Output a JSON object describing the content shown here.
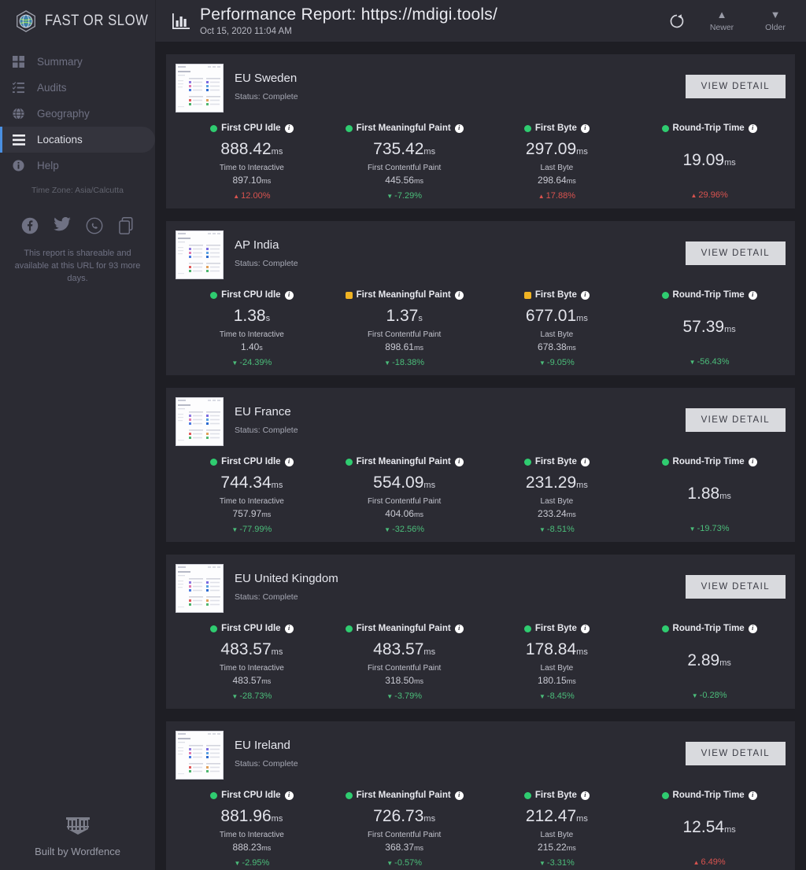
{
  "brand": {
    "name": "FAST OR SLOW",
    "logo_icon": "globe-logo-icon"
  },
  "sidebar": {
    "items": [
      {
        "label": "Summary",
        "icon": "grid-icon",
        "active": false
      },
      {
        "label": "Audits",
        "icon": "checklist-icon",
        "active": false
      },
      {
        "label": "Geography",
        "icon": "globe-icon",
        "active": false
      },
      {
        "label": "Locations",
        "icon": "list-lines-icon",
        "active": true
      },
      {
        "label": "Help",
        "icon": "info-circle-icon",
        "active": false
      }
    ],
    "timezone": "Time Zone: Asia/Calcutta",
    "social": [
      "facebook-icon",
      "twitter-icon",
      "whatsapp-icon",
      "copy-link-icon"
    ],
    "share_note": "This report is shareable and available at this URL for 93 more days.",
    "footer": {
      "label": "Built by Wordfence",
      "icon": "wordfence-icon"
    }
  },
  "topbar": {
    "icon": "bar-chart-icon",
    "title": "Performance Report: https://mdigi.tools/",
    "subtitle": "Oct 15, 2020 11:04 AM",
    "refresh_icon": "refresh-icon",
    "newer": {
      "label": "Newer",
      "icon": "triangle-up-icon"
    },
    "older": {
      "label": "Older",
      "icon": "triangle-down-icon"
    }
  },
  "colors": {
    "good": "#2fcc70",
    "warn": "#f0b323",
    "up": "#d9534f",
    "down": "#4bbd7a",
    "accent": "#4a90e2",
    "card_bg": "#2b2b33",
    "page_bg": "#1e1e24"
  },
  "view_detail_label": "VIEW DETAIL",
  "cards": [
    {
      "name": "EU Sweden",
      "status": "Status: Complete",
      "metrics": [
        {
          "label": "First CPU Idle",
          "state": "good",
          "shape": "circle",
          "value": "888.42",
          "unit": "ms",
          "sublabel": "Time to Interactive",
          "secondary": "897.10",
          "secondary_unit": "ms",
          "delta": "12.00%",
          "delta_dir": "up"
        },
        {
          "label": "First Meaningful Paint",
          "state": "good",
          "shape": "circle",
          "value": "735.42",
          "unit": "ms",
          "sublabel": "First Contentful Paint",
          "secondary": "445.56",
          "secondary_unit": "ms",
          "delta": "-7.29%",
          "delta_dir": "down"
        },
        {
          "label": "First Byte",
          "state": "good",
          "shape": "circle",
          "value": "297.09",
          "unit": "ms",
          "sublabel": "Last Byte",
          "secondary": "298.64",
          "secondary_unit": "ms",
          "delta": "17.88%",
          "delta_dir": "up"
        },
        {
          "label": "Round-Trip Time",
          "state": "good",
          "shape": "circle",
          "value": "19.09",
          "unit": "ms",
          "sublabel": "",
          "secondary": "",
          "secondary_unit": "",
          "delta": "29.96%",
          "delta_dir": "up"
        }
      ]
    },
    {
      "name": "AP India",
      "status": "Status: Complete",
      "metrics": [
        {
          "label": "First CPU Idle",
          "state": "good",
          "shape": "circle",
          "value": "1.38",
          "unit": "s",
          "sublabel": "Time to Interactive",
          "secondary": "1.40",
          "secondary_unit": "s",
          "delta": "-24.39%",
          "delta_dir": "down"
        },
        {
          "label": "First Meaningful Paint",
          "state": "warn",
          "shape": "square",
          "value": "1.37",
          "unit": "s",
          "sublabel": "First Contentful Paint",
          "secondary": "898.61",
          "secondary_unit": "ms",
          "delta": "-18.38%",
          "delta_dir": "down"
        },
        {
          "label": "First Byte",
          "state": "warn",
          "shape": "square",
          "value": "677.01",
          "unit": "ms",
          "sublabel": "Last Byte",
          "secondary": "678.38",
          "secondary_unit": "ms",
          "delta": "-9.05%",
          "delta_dir": "down"
        },
        {
          "label": "Round-Trip Time",
          "state": "good",
          "shape": "circle",
          "value": "57.39",
          "unit": "ms",
          "sublabel": "",
          "secondary": "",
          "secondary_unit": "",
          "delta": "-56.43%",
          "delta_dir": "down"
        }
      ]
    },
    {
      "name": "EU France",
      "status": "Status: Complete",
      "metrics": [
        {
          "label": "First CPU Idle",
          "state": "good",
          "shape": "circle",
          "value": "744.34",
          "unit": "ms",
          "sublabel": "Time to Interactive",
          "secondary": "757.97",
          "secondary_unit": "ms",
          "delta": "-77.99%",
          "delta_dir": "down"
        },
        {
          "label": "First Meaningful Paint",
          "state": "good",
          "shape": "circle",
          "value": "554.09",
          "unit": "ms",
          "sublabel": "First Contentful Paint",
          "secondary": "404.06",
          "secondary_unit": "ms",
          "delta": "-32.56%",
          "delta_dir": "down"
        },
        {
          "label": "First Byte",
          "state": "good",
          "shape": "circle",
          "value": "231.29",
          "unit": "ms",
          "sublabel": "Last Byte",
          "secondary": "233.24",
          "secondary_unit": "ms",
          "delta": "-8.51%",
          "delta_dir": "down"
        },
        {
          "label": "Round-Trip Time",
          "state": "good",
          "shape": "circle",
          "value": "1.88",
          "unit": "ms",
          "sublabel": "",
          "secondary": "",
          "secondary_unit": "",
          "delta": "-19.73%",
          "delta_dir": "down"
        }
      ]
    },
    {
      "name": "EU United Kingdom",
      "status": "Status: Complete",
      "metrics": [
        {
          "label": "First CPU Idle",
          "state": "good",
          "shape": "circle",
          "value": "483.57",
          "unit": "ms",
          "sublabel": "Time to Interactive",
          "secondary": "483.57",
          "secondary_unit": "ms",
          "delta": "-28.73%",
          "delta_dir": "down"
        },
        {
          "label": "First Meaningful Paint",
          "state": "good",
          "shape": "circle",
          "value": "483.57",
          "unit": "ms",
          "sublabel": "First Contentful Paint",
          "secondary": "318.50",
          "secondary_unit": "ms",
          "delta": "-3.79%",
          "delta_dir": "down"
        },
        {
          "label": "First Byte",
          "state": "good",
          "shape": "circle",
          "value": "178.84",
          "unit": "ms",
          "sublabel": "Last Byte",
          "secondary": "180.15",
          "secondary_unit": "ms",
          "delta": "-8.45%",
          "delta_dir": "down"
        },
        {
          "label": "Round-Trip Time",
          "state": "good",
          "shape": "circle",
          "value": "2.89",
          "unit": "ms",
          "sublabel": "",
          "secondary": "",
          "secondary_unit": "",
          "delta": "-0.28%",
          "delta_dir": "down"
        }
      ]
    },
    {
      "name": "EU Ireland",
      "status": "Status: Complete",
      "metrics": [
        {
          "label": "First CPU Idle",
          "state": "good",
          "shape": "circle",
          "value": "881.96",
          "unit": "ms",
          "sublabel": "Time to Interactive",
          "secondary": "888.23",
          "secondary_unit": "ms",
          "delta": "-2.95%",
          "delta_dir": "down"
        },
        {
          "label": "First Meaningful Paint",
          "state": "good",
          "shape": "circle",
          "value": "726.73",
          "unit": "ms",
          "sublabel": "First Contentful Paint",
          "secondary": "368.37",
          "secondary_unit": "ms",
          "delta": "-0.57%",
          "delta_dir": "down"
        },
        {
          "label": "First Byte",
          "state": "good",
          "shape": "circle",
          "value": "212.47",
          "unit": "ms",
          "sublabel": "Last Byte",
          "secondary": "215.22",
          "secondary_unit": "ms",
          "delta": "-3.31%",
          "delta_dir": "down"
        },
        {
          "label": "Round-Trip Time",
          "state": "good",
          "shape": "circle",
          "value": "12.54",
          "unit": "ms",
          "sublabel": "",
          "secondary": "",
          "secondary_unit": "",
          "delta": "6.49%",
          "delta_dir": "up"
        }
      ]
    }
  ]
}
